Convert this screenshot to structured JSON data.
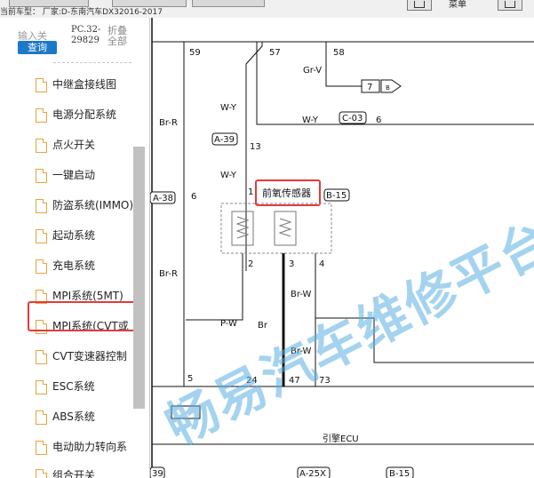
{
  "header": {
    "car_type": "当前车型：  厂家:D-东南汽车DX32016-2017",
    "menu_label": "菜单"
  },
  "sidebar": {
    "input_placeholder": "输入关",
    "search_button": "查询",
    "code": "PC.32-29829",
    "fold": "折叠全部",
    "items": [
      {
        "label": "中继盒接线图"
      },
      {
        "label": "电源分配系统"
      },
      {
        "label": "点火开关"
      },
      {
        "label": "一键启动"
      },
      {
        "label": "防盗系统(IMMO)"
      },
      {
        "label": "起动系统"
      },
      {
        "label": "充电系统"
      },
      {
        "label": "MPI系统(5MT)"
      },
      {
        "label": "MPI系统(CVT或"
      },
      {
        "label": "CVT变速器控制"
      },
      {
        "label": "ESC系统"
      },
      {
        "label": "ABS系统"
      },
      {
        "label": "电动助力转向系"
      },
      {
        "label": "组合开关"
      }
    ]
  },
  "diagram": {
    "pins": {
      "p59": "59",
      "p57": "57",
      "p58": "58",
      "p13": "13",
      "p6": "6",
      "p1": "1",
      "p2": "2",
      "p3": "3",
      "p4": "4",
      "p5": "5",
      "p24": "24",
      "p47": "47",
      "p73": "73",
      "p6b": "6"
    },
    "wires": {
      "grv": "Gr-V",
      "wy1": "W-Y",
      "brr1": "Br-R",
      "wy2": "W-Y",
      "wy3": "W-Y",
      "brr2": "Br-R",
      "brw1": "Br-W",
      "pw": "P-W",
      "br": "Br",
      "brw2": "Br-W"
    },
    "connectors": {
      "c03": "C-03",
      "a39": "A-39",
      "a38": "A-38",
      "b15": "B-15",
      "c7": "7",
      "cb": "B",
      "b15b": "B-15",
      "a25x": "A-25X",
      "c39": "39"
    },
    "sensor_label": "前氧传感器",
    "ecu_label": "引擎ECU"
  },
  "watermark": "畅易汽车维修平台",
  "colors": {
    "accent": "#1e78c8",
    "highlight": "#e23b3b",
    "folder": "#e8a43a"
  }
}
